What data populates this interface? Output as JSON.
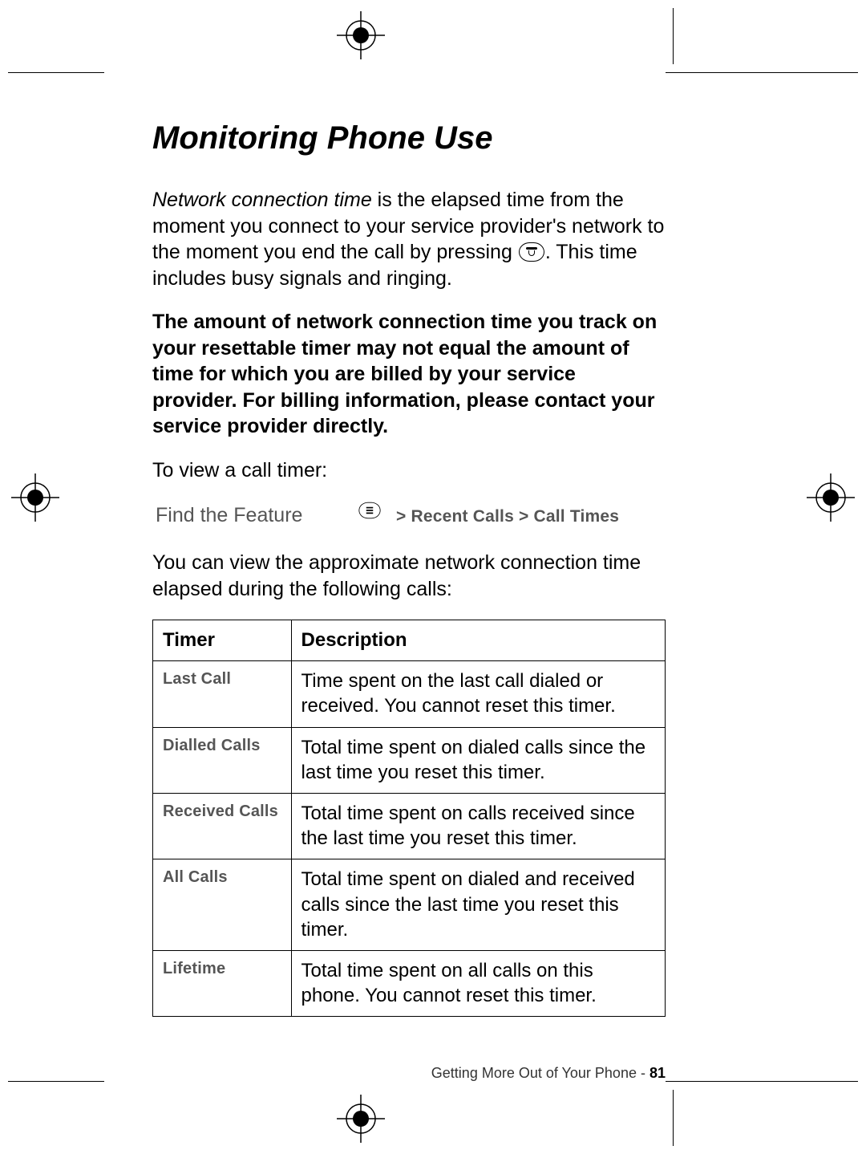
{
  "title": "Monitoring Phone Use",
  "intro": {
    "term": "Network connection time",
    "before_icon": " is the elapsed time from the moment you connect to your service provider's network to the moment you end the call by pressing ",
    "after_icon": ". This time includes busy signals and ringing."
  },
  "billing_notice": "The amount of network connection time you track on your resettable timer may not equal the amount of time for which you are billed by your service provider. For billing information, please contact your service provider directly.",
  "view_timer_label": "To view a call timer:",
  "feature": {
    "label": "Find the Feature",
    "path": "> Recent Calls > Call Times"
  },
  "after_feature": "You can view the approximate network connection time elapsed during the following calls:",
  "table": {
    "head": {
      "timer": "Timer",
      "desc": "Description"
    },
    "rows": [
      {
        "name": "Last Call",
        "desc": "Time spent on the last call dialed or received. You cannot reset this timer."
      },
      {
        "name": "Dialled Calls",
        "desc": "Total time spent on dialed calls since the last time you reset this timer."
      },
      {
        "name": "Received Calls",
        "desc": "Total time spent on calls received since the last time you reset this timer."
      },
      {
        "name": "All Calls",
        "desc": "Total time spent on dialed and received calls since the last time you reset this timer."
      },
      {
        "name": "Lifetime",
        "desc": "Total time spent on all calls on this phone. You cannot reset this timer."
      }
    ]
  },
  "footer": {
    "section": "Getting More Out of Your Phone - ",
    "page": "81"
  }
}
